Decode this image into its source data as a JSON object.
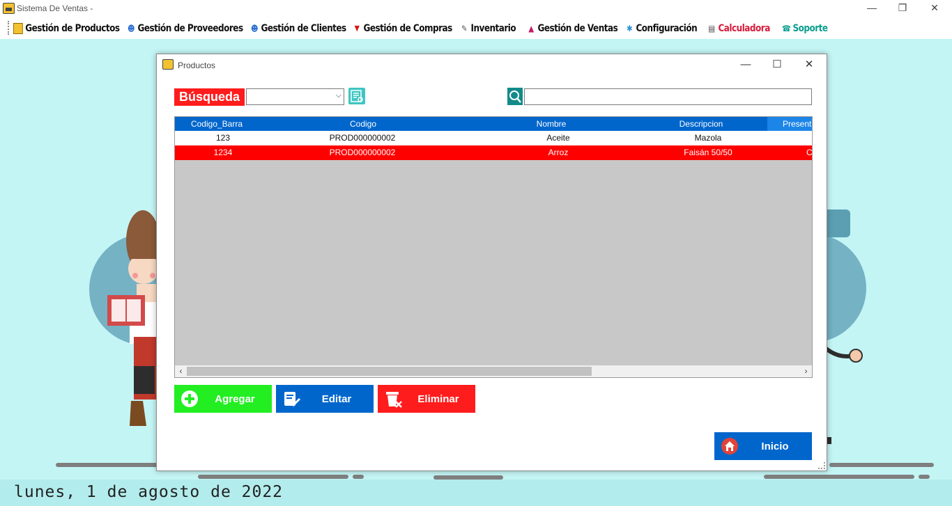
{
  "window": {
    "title": "Sistema De Ventas -",
    "controls": {
      "minimize": "—",
      "restore": "❐",
      "close": "✕"
    }
  },
  "menu": [
    {
      "label": "Gestión de Productos",
      "icon": "box-icon",
      "glyph": "▦",
      "color": "#111111"
    },
    {
      "label": "Gestión de Proveedores",
      "icon": "supplier-icon",
      "glyph": "☻",
      "color": "#111111"
    },
    {
      "label": "Gestión de Clientes",
      "icon": "client-icon",
      "glyph": "☻",
      "color": "#111111"
    },
    {
      "label": "Gestión de Compras",
      "icon": "cart-icon",
      "glyph": "🛒",
      "color": "#111111"
    },
    {
      "label": "Inventario",
      "icon": "inventory-icon",
      "glyph": "✎",
      "color": "#111111"
    },
    {
      "label": "Gestión de Ventas",
      "icon": "sales-chart-icon",
      "glyph": "▲",
      "color": "#111111"
    },
    {
      "label": "Configuración",
      "icon": "settings-icon",
      "glyph": "✱",
      "color": "#111111"
    },
    {
      "label": "Calculadora",
      "icon": "calculator-icon",
      "glyph": "▤",
      "color": "#d81b3c"
    },
    {
      "label": "Soporte",
      "icon": "phone-icon",
      "glyph": "☎",
      "color": "#0a9e8e"
    }
  ],
  "dialog": {
    "title": "Productos",
    "search_label": "Búsqueda",
    "combo_value": "",
    "search_value": "",
    "columns": [
      "Codigo_Barra",
      "Codigo",
      "Nombre",
      "Descripcion",
      "Present"
    ],
    "rows": [
      {
        "codigo_barra": "123",
        "codigo": "PROD000000002",
        "nombre": "Aceite",
        "descripcion": "Mazola",
        "present": ""
      },
      {
        "codigo_barra": "1234",
        "codigo": "PROD000000002",
        "nombre": "Arroz",
        "descripcion": "Faisán 50/50",
        "present": "C"
      }
    ],
    "buttons": {
      "agregar": "Agregar",
      "editar": "Editar",
      "eliminar": "Eliminar",
      "inicio": "Inicio"
    }
  },
  "status": {
    "date": "lunes, 1 de agosto de 2022"
  },
  "colors": {
    "accent_blue": "#0066cc",
    "selected_row": "#ff0000",
    "add_green": "#22ee22",
    "delete_red": "#ff1c1c",
    "desktop_bg": "#c4f5f5"
  }
}
